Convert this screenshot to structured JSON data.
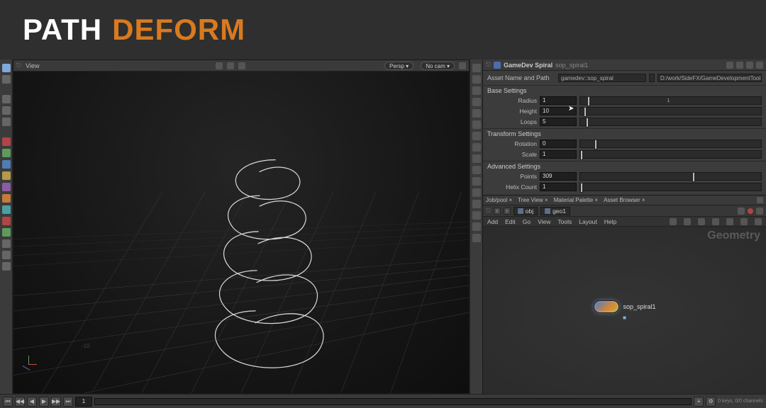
{
  "title": {
    "word1": "PATH",
    "word2": "DEFORM"
  },
  "viewport": {
    "tab_label": "View",
    "camera_menu": "Persp ▾",
    "no_cam": "No cam ▾",
    "grid_label": "-10"
  },
  "timeline": {
    "frame": "1",
    "status": "0 keys, 0/0 channels"
  },
  "param_pane": {
    "header_type": "GameDev Spiral",
    "header_name": "sop_spiral1",
    "asset_row_label": "Asset Name and Path",
    "asset_name": "gamedev::sop_spiral",
    "asset_path": "D:/work/SideFX/GameDevelopmentToolset/otls/gamedev_sop_spi",
    "sections": {
      "base": "Base Settings",
      "transform": "Transform Settings",
      "advanced": "Advanced Settings"
    },
    "params": {
      "radius": {
        "label": "Radius",
        "value": "1",
        "mark": "1",
        "thumb_pct": 4
      },
      "height": {
        "label": "Height",
        "value": "10",
        "thumb_pct": 2
      },
      "loops": {
        "label": "Loops",
        "value": "5",
        "thumb_pct": 3
      },
      "rotation": {
        "label": "Rotation",
        "value": "0",
        "thumb_pct": 8
      },
      "scale": {
        "label": "Scale",
        "value": "1",
        "thumb_pct": 0
      },
      "points": {
        "label": "Points",
        "value": "309",
        "thumb_pct": 62
      },
      "helix_count": {
        "label": "Helix Count",
        "value": "1",
        "thumb_pct": 0
      }
    }
  },
  "network": {
    "tabs": {
      "jobspool": "Job/pool ×",
      "treeview": "Tree View ×",
      "matpal": "Material Palette ×",
      "assetb": "Asset Browser ×"
    },
    "crumbs": {
      "obj": "obj",
      "geo": "geo1"
    },
    "menu": {
      "add": "Add",
      "edit": "Edit",
      "go": "Go",
      "view": "View",
      "tools": "Tools",
      "layout": "Layout",
      "help": "Help"
    },
    "ghost": "Geometry",
    "node_label": "sop_spiral1",
    "node_flag": "■"
  }
}
